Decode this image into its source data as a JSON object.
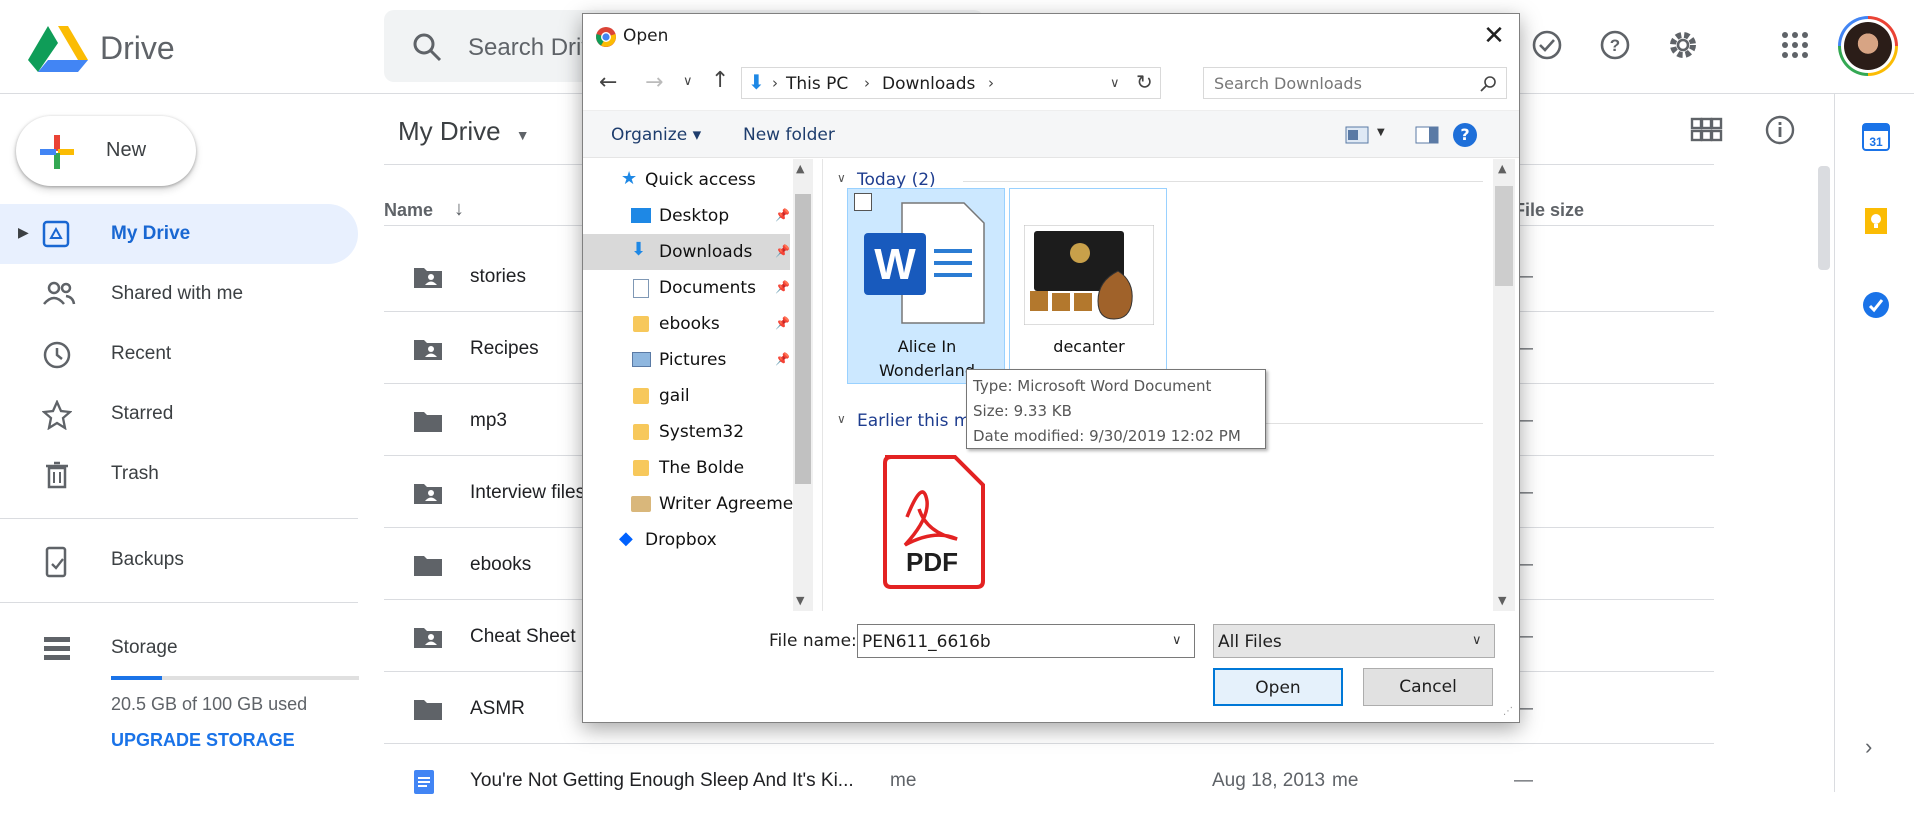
{
  "app": {
    "brand": "Drive"
  },
  "search": {
    "placeholder": "Search Drive"
  },
  "sidebar": {
    "new_label": "New",
    "items": [
      {
        "label": "My Drive"
      },
      {
        "label": "Shared with me"
      },
      {
        "label": "Recent"
      },
      {
        "label": "Starred"
      },
      {
        "label": "Trash"
      },
      {
        "label": "Backups"
      },
      {
        "label": "Storage"
      }
    ],
    "storage_used": "20.5 GB of 100 GB used",
    "storage_fraction": 0.205,
    "upgrade_label": "UPGRADE STORAGE"
  },
  "main": {
    "title": "My Drive",
    "col_name": "Name",
    "col_size": "File size",
    "rows": [
      {
        "name": "stories",
        "shared": true
      },
      {
        "name": "Recipes",
        "shared": true
      },
      {
        "name": "mp3",
        "shared": false
      },
      {
        "name": "Interview files",
        "shared": true
      },
      {
        "name": "ebooks",
        "shared": false
      },
      {
        "name": "Cheat Sheet",
        "shared": true
      },
      {
        "name": "ASMR",
        "shared": false
      }
    ],
    "last_row": {
      "name": "You're Not Getting Enough Sleep And It's Ki...",
      "owner": "me",
      "date": "Aug 18, 2013",
      "modifier": "me",
      "size": "—"
    },
    "dash": "—"
  },
  "dialog": {
    "title": "Open",
    "close": "✕",
    "path": [
      "This PC",
      "Downloads"
    ],
    "search_placeholder": "Search Downloads",
    "toolbar": {
      "organize": "Organize ▾",
      "new_folder": "New folder",
      "help": "?"
    },
    "nav": [
      {
        "label": "Quick access"
      },
      {
        "label": "Desktop"
      },
      {
        "label": "Downloads"
      },
      {
        "label": "Documents"
      },
      {
        "label": "ebooks"
      },
      {
        "label": "Pictures"
      },
      {
        "label": "gail"
      },
      {
        "label": "System32"
      },
      {
        "label": "The Bolde"
      },
      {
        "label": "Writer Agreemen"
      },
      {
        "label": "Dropbox"
      }
    ],
    "groups": {
      "today": "Today (2)",
      "earlier": "Earlier this month"
    },
    "files": [
      {
        "line1": "Alice In",
        "line2": "Wonderland"
      },
      {
        "line1": "decanter",
        "line2": ""
      }
    ],
    "pdf_label": "PDF",
    "tooltip": {
      "type": "Type: Microsoft Word Document",
      "size": "Size: 9.33 KB",
      "date": "Date modified: 9/30/2019 12:02 PM"
    },
    "file_name_label": "File name:",
    "file_name_value": "PEN611_6616b",
    "file_type": "All Files",
    "open_label": "Open",
    "cancel_label": "Cancel"
  }
}
